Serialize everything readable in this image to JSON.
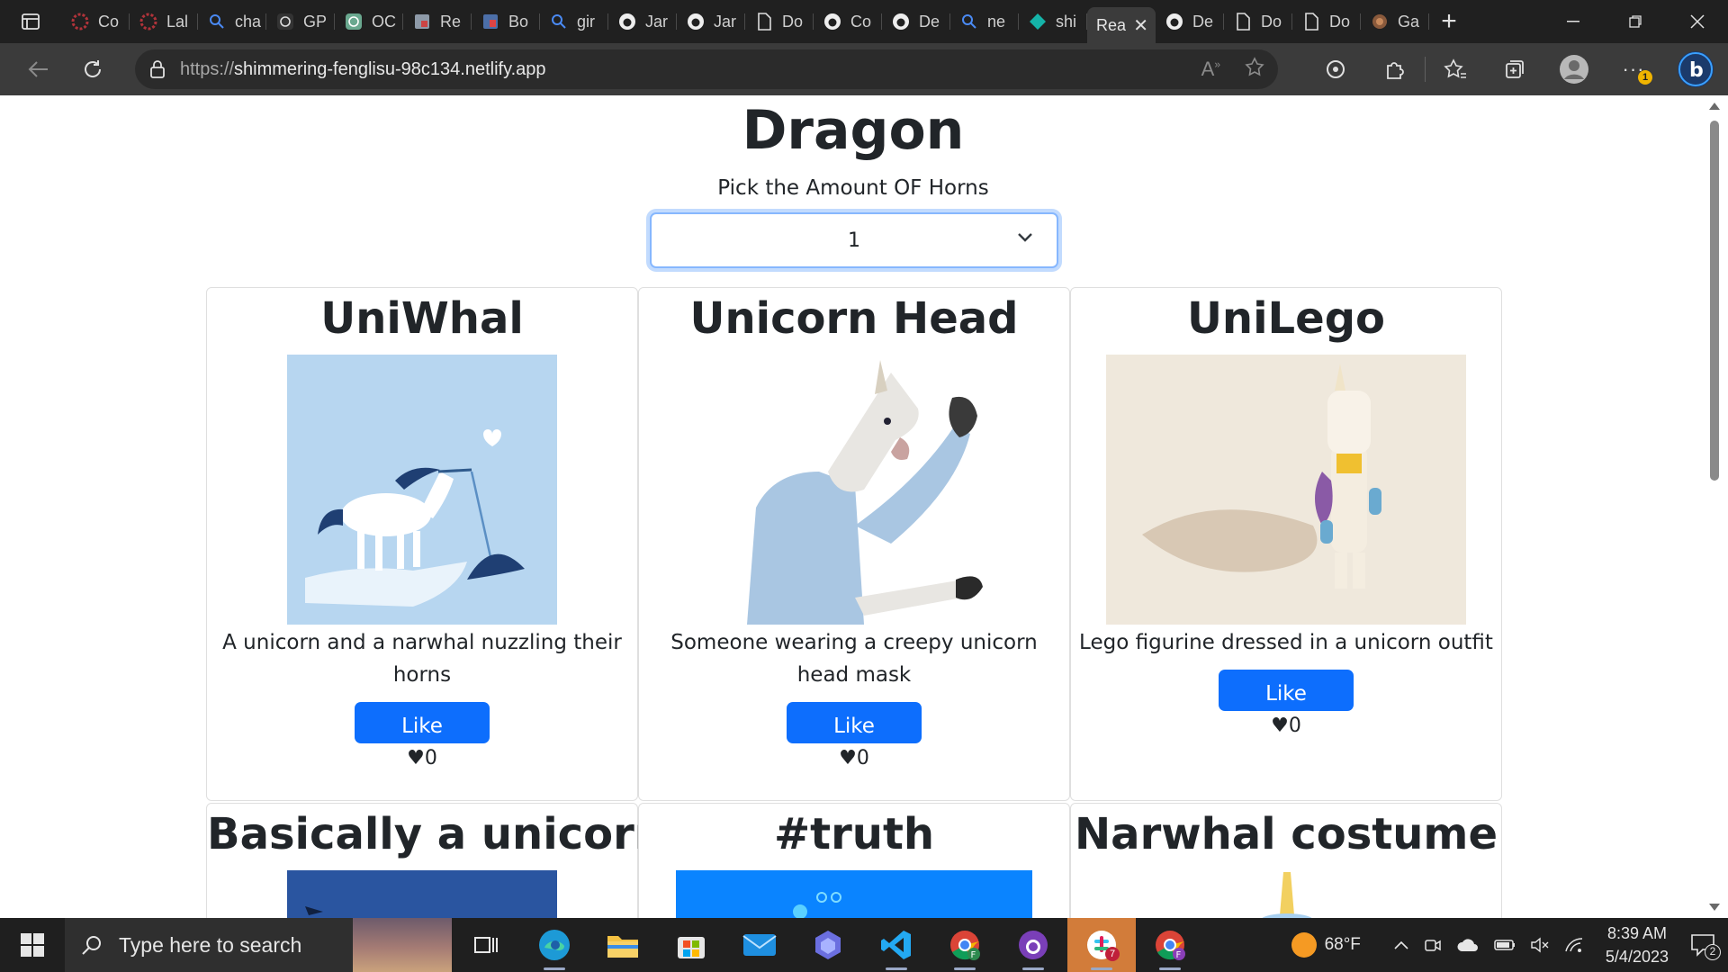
{
  "browser": {
    "tabs": [
      {
        "title": "Co",
        "icon": "lambda-school-icon"
      },
      {
        "title": "Lal",
        "icon": "lambda-school-icon"
      },
      {
        "title": "cha",
        "icon": "search-icon"
      },
      {
        "title": "GP",
        "icon": "openai-icon"
      },
      {
        "title": "OC",
        "icon": "openai-icon"
      },
      {
        "title": "Re",
        "icon": "app-icon"
      },
      {
        "title": "Bo",
        "icon": "trello-icon"
      },
      {
        "title": "gir",
        "icon": "search-icon"
      },
      {
        "title": "Jar",
        "icon": "github-icon"
      },
      {
        "title": "Jar",
        "icon": "github-icon"
      },
      {
        "title": "Do",
        "icon": "document-icon"
      },
      {
        "title": "Co",
        "icon": "github-icon"
      },
      {
        "title": "De",
        "icon": "github-icon"
      },
      {
        "title": "ne",
        "icon": "search-icon"
      },
      {
        "title": "shi",
        "icon": "netlify-icon"
      }
    ],
    "active_tab": {
      "title": "Rea",
      "icon": "close-icon"
    },
    "tabs_after": [
      {
        "title": "De",
        "icon": "github-icon"
      },
      {
        "title": "Do",
        "icon": "document-icon"
      },
      {
        "title": "Do",
        "icon": "document-icon"
      },
      {
        "title": "Ga",
        "icon": "app-icon"
      }
    ],
    "url_protocol": "https://",
    "url_host": "shimmering-fenglisu-98c134.netlify.app",
    "notification_badge": "1"
  },
  "page": {
    "title": "Dragon",
    "prompt": "Pick the Amount OF Horns",
    "selected_horns": "1",
    "cards": [
      {
        "title": "UniWhal",
        "description": "A unicorn and a narwhal nuzzling their horns",
        "like_label": "Like",
        "likes": "0"
      },
      {
        "title": "Unicorn Head",
        "description": "Someone wearing a creepy unicorn head mask",
        "like_label": "Like",
        "likes": "0"
      },
      {
        "title": "UniLego",
        "description": "Lego figurine dressed in a unicorn outfit",
        "like_label": "Like",
        "likes": "0"
      },
      {
        "title": "Basically a unicorn"
      },
      {
        "title": "#truth"
      },
      {
        "title": "Narwhal costume"
      }
    ],
    "heart_glyph": "♥"
  },
  "taskbar": {
    "search_placeholder": "Type here to search",
    "weather": "68°F",
    "time": "8:39 AM",
    "date": "5/4/2023",
    "notifications": "2",
    "slack_badge": "7"
  },
  "colors": {
    "primary": "#0d6efd",
    "focus_ring": "#86b7fe"
  }
}
